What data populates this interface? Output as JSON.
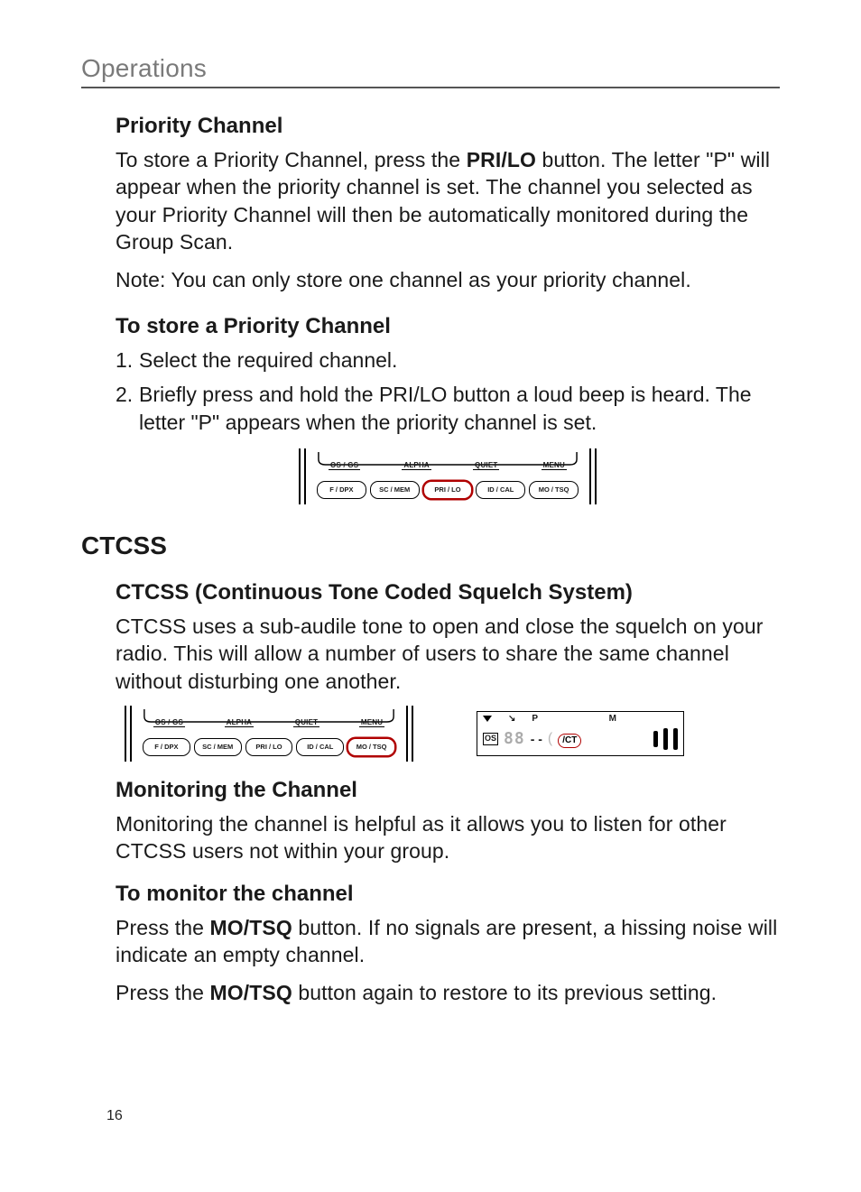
{
  "running_head": "Operations",
  "page_number": "16",
  "priority": {
    "heading": "Priority Channel",
    "para1_a": "To store a Priority Channel, press the ",
    "para1_bold": "PRI/LO",
    "para1_b": " button. The letter \"P\" will appear when the priority channel is set. The channel you selected as your Priority Channel will then be automatically monitored during the Group Scan.",
    "note": "Note: You can only store one channel as your priority channel.",
    "store_heading": "To store a Priority Channel",
    "steps": {
      "s1": "Select the required channel.",
      "s2_a": "Briefly press and hold the ",
      "s2_bold": "PRI/LO",
      "s2_b": " button a loud beep is heard. The letter \"P\" appears when the priority channel is set."
    }
  },
  "ctcss": {
    "heading": "CTCSS",
    "sub_heading": "CTCSS (Continuous Tone Coded Squelch System)",
    "para": "CTCSS uses a sub-audile tone to open and close the squelch on your radio. This will allow a number of users to share the same channel without disturbing one another.",
    "monitor_heading": "Monitoring the Channel",
    "monitor_para": "Monitoring the channel is helpful as it allows you to listen for other CTCSS users not within your group.",
    "to_monitor_heading": "To monitor the channel",
    "to_monitor_p1_a": "Press the ",
    "to_monitor_p1_bold": "MO/TSQ",
    "to_monitor_p1_b": " button. If no signals are present, a hissing noise will indicate an empty channel.",
    "to_monitor_p2_a": "Press the ",
    "to_monitor_p2_bold": "MO/TSQ",
    "to_monitor_p2_b": " button again to restore to its previous setting."
  },
  "panel": {
    "top_labels": [
      "OS / GS",
      "ALPHA",
      "QUIET",
      "MENU"
    ],
    "buttons": [
      "F / DPX",
      "SC / MEM",
      "PRI / LO",
      "ID / CAL",
      "MO / TSQ"
    ]
  },
  "lcd": {
    "p": "P",
    "m": "M",
    "os": "OS",
    "seg": "88",
    "dashes": "- -",
    "ct": "/CT"
  }
}
